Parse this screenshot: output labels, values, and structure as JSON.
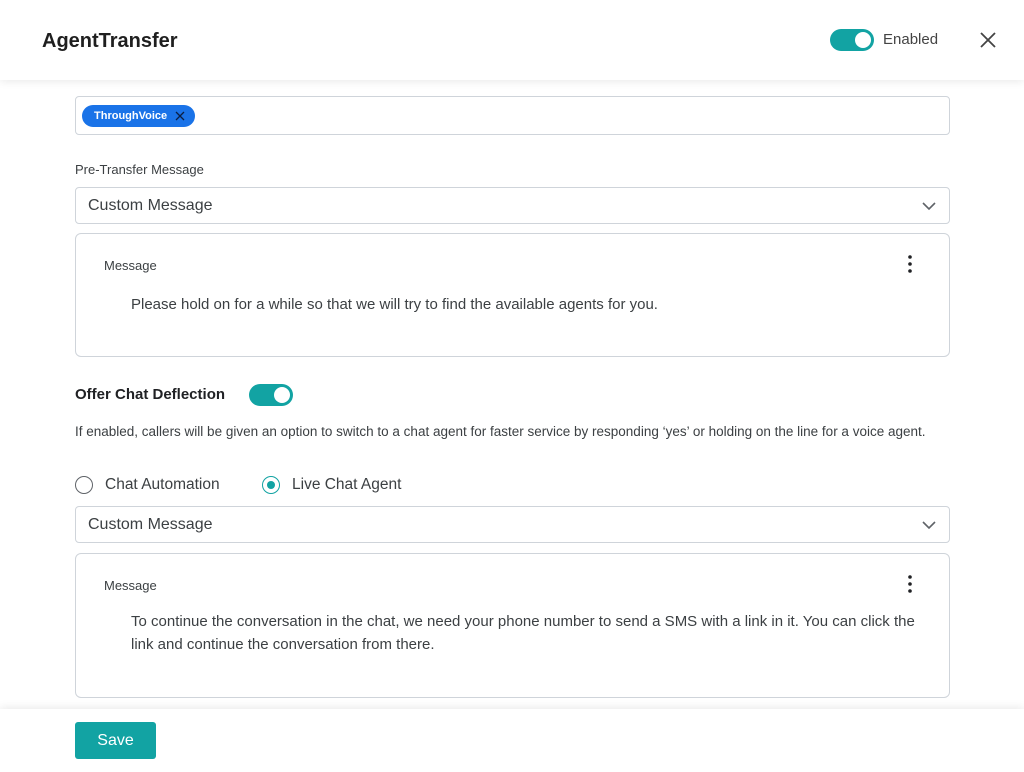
{
  "header": {
    "title": "AgentTransfer",
    "enabled_toggle": {
      "on": true,
      "label": "Enabled"
    }
  },
  "chips": [
    {
      "label": "ThroughVoice"
    }
  ],
  "pre_transfer": {
    "label": "Pre-Transfer Message",
    "select_value": "Custom Message",
    "message_label": "Message",
    "message_text": "Please hold on for a while so that we will try to find the available agents for you."
  },
  "deflection": {
    "label": "Offer Chat Deflection",
    "enabled": true,
    "help_text": "If enabled, callers will be given an option to switch to a chat agent for faster service by responding ‘yes’ or holding on the line for a voice agent.",
    "options": [
      {
        "label": "Chat Automation",
        "selected": false
      },
      {
        "label": "Live Chat Agent",
        "selected": true
      }
    ],
    "select_value": "Custom Message",
    "message_label": "Message",
    "message_text": "To continue the conversation in the chat, we need your phone number to send a SMS with a link in it. You can click the link and continue the conversation from there."
  },
  "footer": {
    "save_label": "Save"
  },
  "colors": {
    "accent": "#12a3a3",
    "chip": "#1a73e8"
  }
}
